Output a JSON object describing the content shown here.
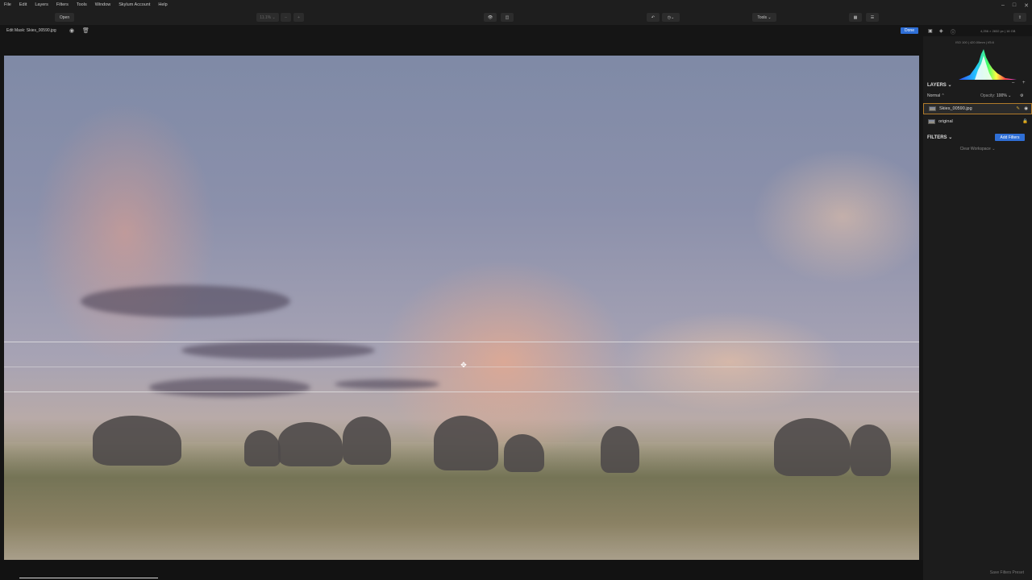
{
  "menu": [
    "File",
    "Edit",
    "Layers",
    "Filters",
    "Tools",
    "Window",
    "Skylum Account",
    "Help"
  ],
  "window_controls": [
    "–",
    "□",
    "✕"
  ],
  "toolbar": {
    "open_label": "Open",
    "zoom_label": "11.1% ⌄",
    "zoom_out": "–",
    "zoom_in": "+",
    "tools_label": "Tools ⌄"
  },
  "subbar": {
    "title": "Edit Mask: Skies_00590.jpg",
    "done_label": "Done"
  },
  "panel": {
    "histo_info": "ISO 100  |  420.00mm  |  f/5.6",
    "image_info": "4,256 × 2832 px  |  16 GB",
    "layers_title": "LAYERS ⌄",
    "blend_mode": "Normal ⌃",
    "opacity_label": "Opacity:",
    "opacity_value": "100% ⌄",
    "layers": [
      {
        "name": "Skies_00590.jpg",
        "active": true
      },
      {
        "name": "original",
        "active": false
      }
    ],
    "filters_title": "FILTERS ⌄",
    "add_filters_label": "Add Filters",
    "clear_workspace_label": "Clear Workspace ⌄",
    "save_preset_label": "Save Filters Preset"
  },
  "colors": {
    "accent_blue": "#2f6fd6",
    "active_layer_border": "#b07b2b"
  }
}
